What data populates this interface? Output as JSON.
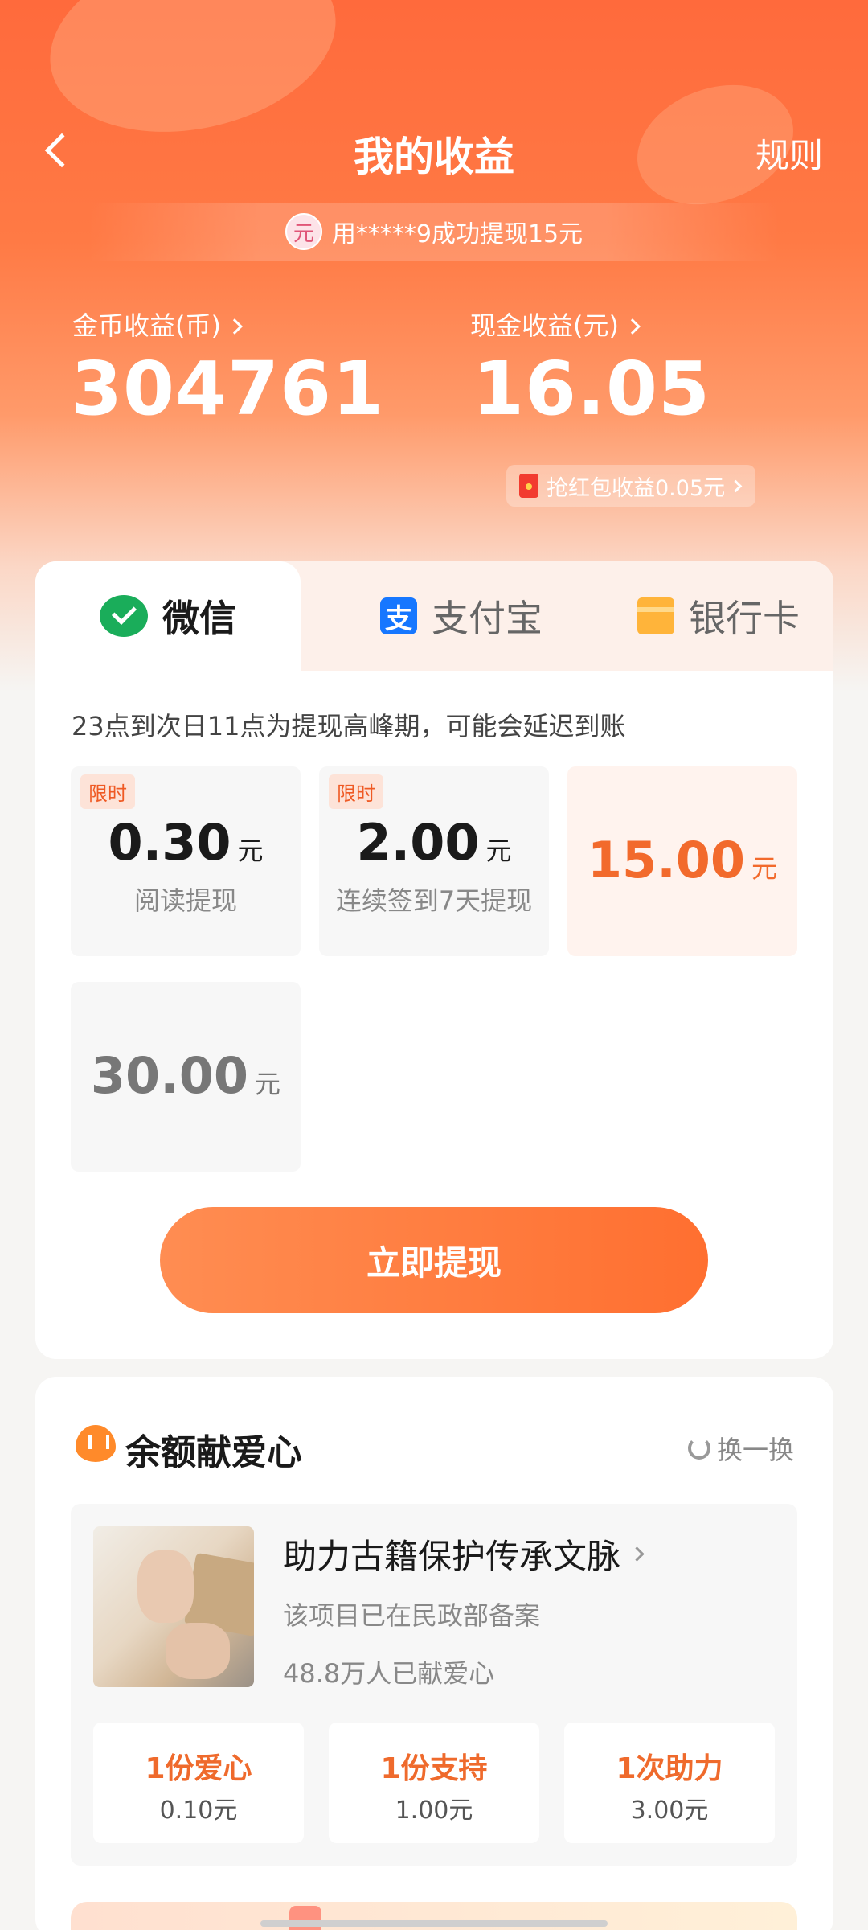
{
  "header": {
    "title": "我的收益",
    "rules_label": "规则",
    "ticker_avatar_char": "元",
    "ticker_text": "用*****9成功提现15元"
  },
  "earnings": {
    "coin_label": "金币收益(币)",
    "coin_value": "304761",
    "cash_label": "现金收益(元)",
    "cash_value": "16.05",
    "redpack_text": "抢红包收益0.05元"
  },
  "withdraw": {
    "tabs": [
      {
        "label": "微信",
        "icon": "wechat-icon",
        "active": true
      },
      {
        "label": "支付宝",
        "icon": "alipay-icon",
        "icon_char": "支",
        "active": false
      },
      {
        "label": "银行卡",
        "icon": "bank-card-icon",
        "active": false
      }
    ],
    "notice": "23点到次日11点为提现高峰期，可能会延迟到账",
    "options": [
      {
        "tag": "限时",
        "amount": "0.30",
        "unit": "元",
        "desc": "阅读提现"
      },
      {
        "tag": "限时",
        "amount": "2.00",
        "unit": "元",
        "desc": "连续签到7天提现"
      },
      {
        "amount": "15.00",
        "unit": "元",
        "selected": true
      },
      {
        "amount": "30.00",
        "unit": "元"
      }
    ],
    "button_label": "立即提现"
  },
  "donation": {
    "title": "余额献爱心",
    "refresh_label": "换一换",
    "project": {
      "title": "助力古籍保护传承文脉",
      "subtitle": "该项目已在民政部备案",
      "count_text": "48.8万人已献爱心"
    },
    "buttons": [
      {
        "title": "1份爱心",
        "price": "0.10元"
      },
      {
        "title": "1份支持",
        "price": "1.00元"
      },
      {
        "title": "1次助力",
        "price": "3.00元"
      }
    ]
  },
  "colors": {
    "accent": "#ff6f30",
    "header_gradient_top": "#ff6a3c",
    "wechat_green": "#1aad5a",
    "alipay_blue": "#1677ff",
    "bank_yellow": "#ffb43a"
  }
}
